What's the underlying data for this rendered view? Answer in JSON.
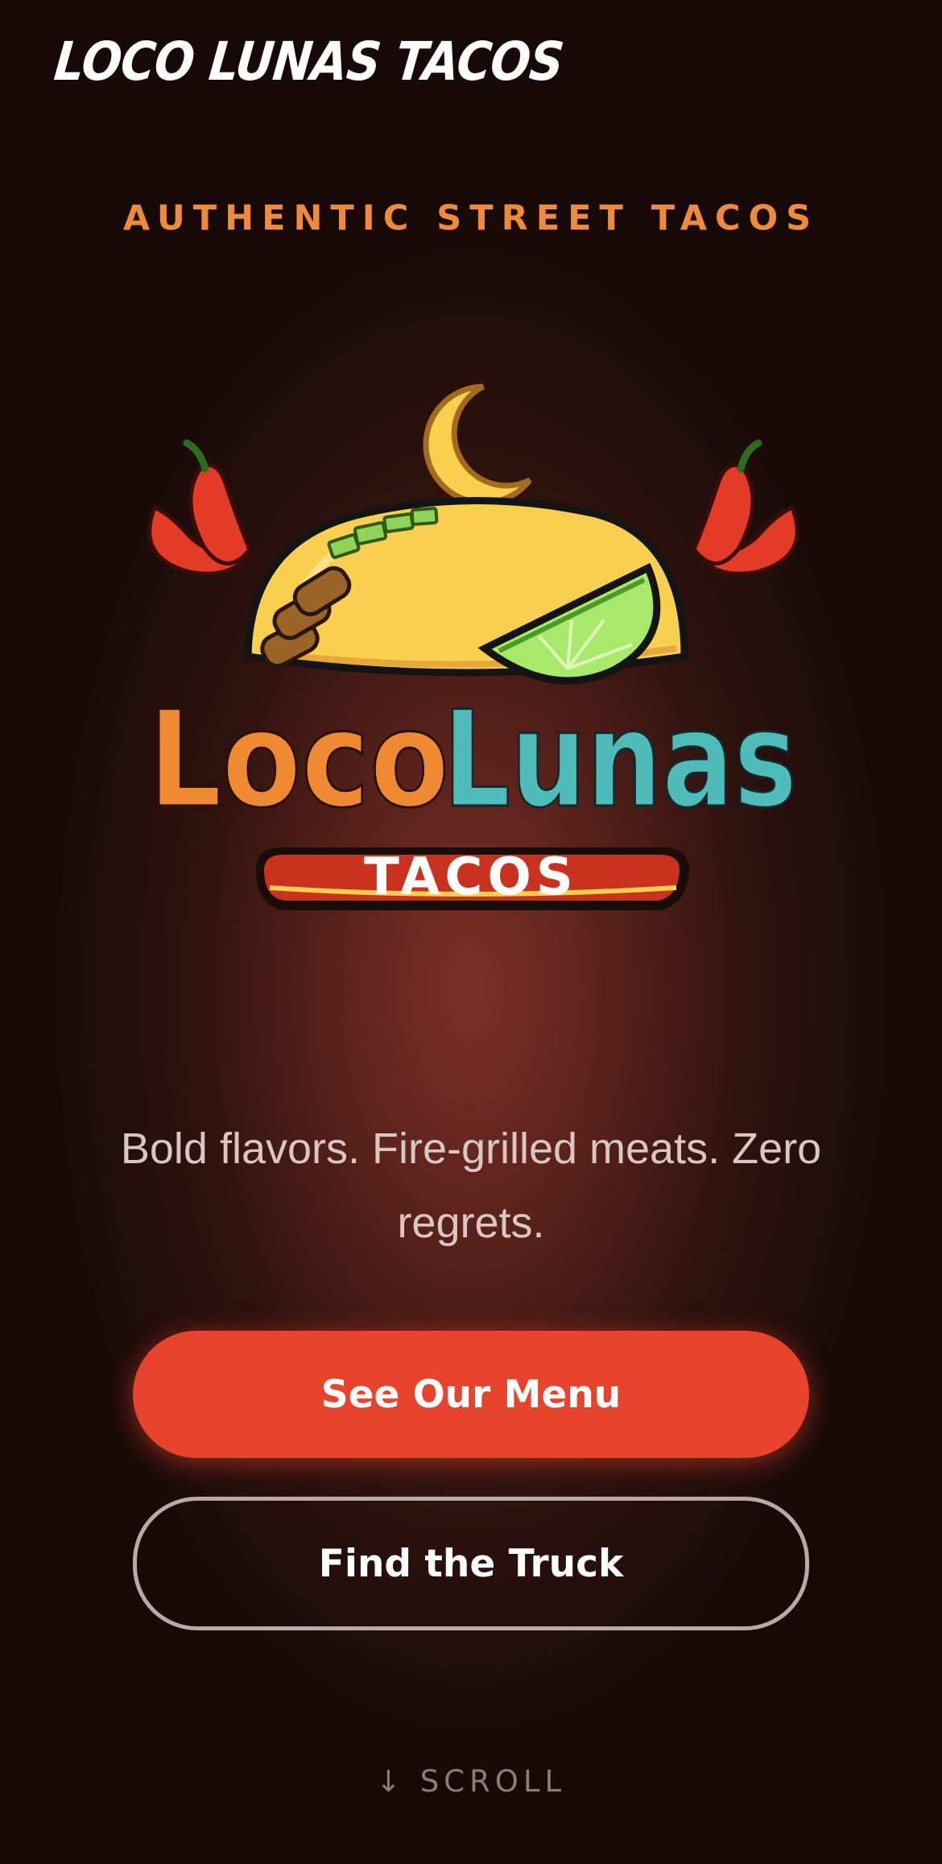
{
  "header": {
    "title": "LOCO LUNAS TACOS"
  },
  "hero": {
    "tagline": "AUTHENTIC STREET TACOS",
    "logo": {
      "word1": "Loco",
      "word2": "Lunas",
      "banner": "TACOS",
      "icons": [
        "crescent-moon",
        "taco",
        "lime-wedge",
        "chili-pepper"
      ]
    },
    "subtitle": "Bold flavors. Fire-grilled meats. Zero regrets.",
    "primary_button": "See Our Menu",
    "secondary_button": "Find the Truck",
    "scroll_arrow": "↓",
    "scroll_label": "SCROLL"
  },
  "colors": {
    "accent": "#e8432c",
    "tagline": "#ef8a3a",
    "logo_orange": "#ef8a33",
    "logo_teal": "#4fbcb9",
    "banner_red": "#c9321f",
    "taco_yellow": "#f8cf4f",
    "lime_green": "#a8e86a"
  }
}
